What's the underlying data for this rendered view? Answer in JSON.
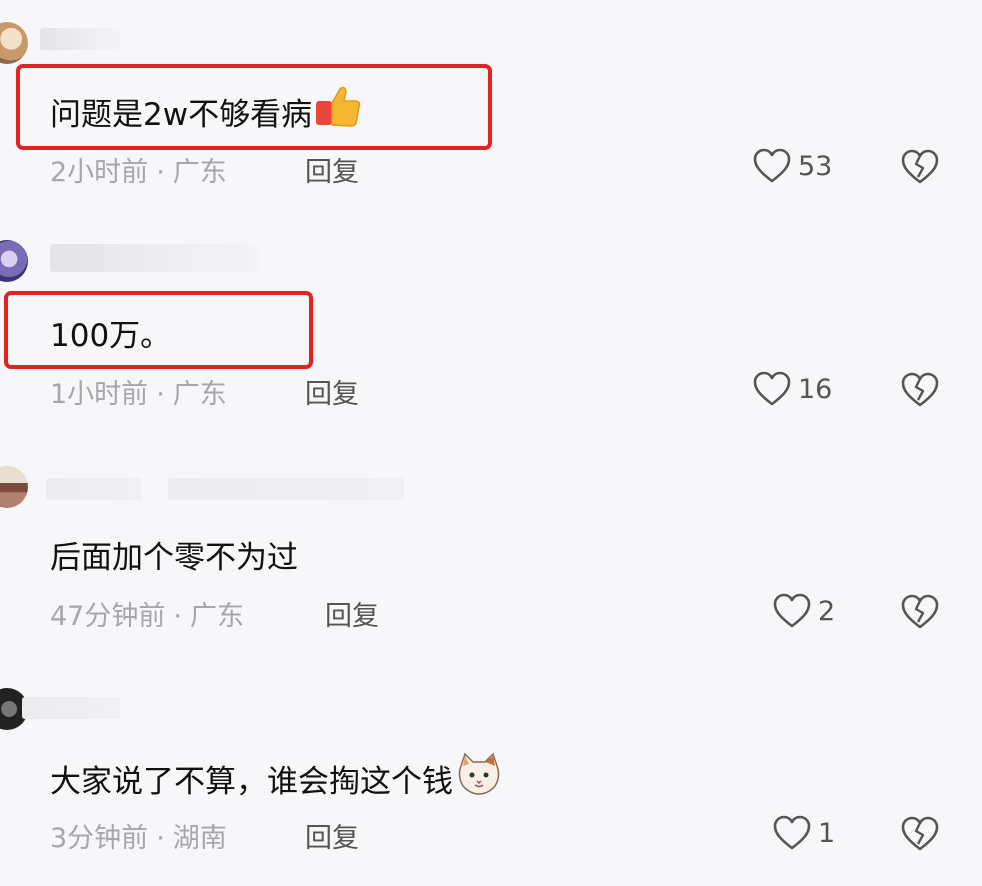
{
  "comments": [
    {
      "text": "问题是2w不够看病",
      "time": "2小时前",
      "location": "广东",
      "reply": "回复",
      "likes": "53",
      "emoji": "thumbs-up"
    },
    {
      "text": "100万。",
      "time": "1小时前",
      "location": "广东",
      "reply": "回复",
      "likes": "16"
    },
    {
      "text": "后面加个零不为过",
      "time": "47分钟前",
      "location": "广东",
      "reply": "回复",
      "likes": "2"
    },
    {
      "text": "大家说了不算，谁会掏这个钱",
      "time": "3分钟前",
      "location": "湖南",
      "reply": "回复",
      "likes": "1",
      "emoji": "cat-face"
    }
  ],
  "separator": "·",
  "colors": {
    "highlight": "#e02424",
    "meta": "#a6a6ad",
    "icon": "#555555"
  }
}
